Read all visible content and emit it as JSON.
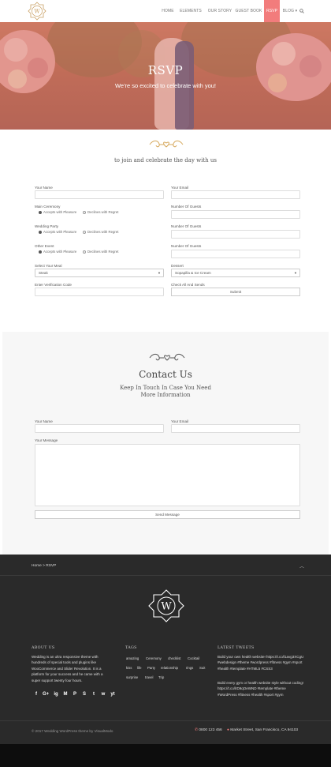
{
  "header": {
    "logo_letter": "W",
    "nav": [
      {
        "label": "HOME"
      },
      {
        "label": "ELEMENTS"
      },
      {
        "label": "OUR STORY"
      },
      {
        "label": "GUEST BOOK"
      },
      {
        "label": "RSVP",
        "active": true
      },
      {
        "label": "BLOG"
      }
    ],
    "accent": "#f27c7c"
  },
  "hero": {
    "title": "RSVP",
    "subtitle": "We're so excited to celebrate with you!"
  },
  "rsvp": {
    "tagline": "to join and celebrate the day with us",
    "your_name": "Your Name",
    "your_email": "Your Email",
    "main_ceremony": "Main Ceremony",
    "wedding_party": "Wedding Party",
    "other_event": "Other Event",
    "accept": "Accepts with Pleasure",
    "decline": "Declines with Regret",
    "guests": "Number Of Guests",
    "select_meal": "Select Your Meal",
    "meal_value": "Steak",
    "dessert": "Dessert",
    "dessert_value": "Sopapilla & Ice Cream",
    "verification": "Enter Verification Code",
    "check_all": "Check All And Sends",
    "submit": "Submit"
  },
  "contact": {
    "title": "Contact Us",
    "subtitle": "Keep In Touch In Case You Need More Information",
    "your_name": "Your Name",
    "your_email": "Your Email",
    "message": "Your Message",
    "send": "Send Message"
  },
  "footer": {
    "breadcrumb": "Home > RSVP",
    "logo_letter": "W",
    "about_title": "ABOUT US",
    "about_text": "Wedding is an ultra responsive theme with hundreds of special tools and plugins like WooCommerce and Slider Revolution. It is a platform for your success and he came with a super support twenty four hours.",
    "tags_title": "TAGS",
    "tags": [
      "amazing",
      "Ceremony",
      "checklist",
      "Cocktail",
      "kiss",
      "life",
      "Party",
      "relationship",
      "rings",
      "Suit",
      "surprise",
      "travel",
      "Trip"
    ],
    "tweets_title": "LATEST TWEETS",
    "tweet1": "Build your own health website! https://t.co/l1avg3XCgU #webdesign #theme #wordpress #fitness #gym #sport #health #template #HTML5 #CSS3",
    "tweet2": "Build every gym or health website style without coding! https://t.co/lrD9qOeWND #template #theme #WordPress #fitness #health #sport #gym",
    "social": [
      "f",
      "G+",
      "ig",
      "M",
      "P",
      "S",
      "t",
      "w",
      "yt"
    ],
    "copyright": "© 2017 Wedding WordPress theme by VisualModo",
    "phone": "0800 123 456",
    "address": "Market Street, San Francisco, CA 94103"
  }
}
